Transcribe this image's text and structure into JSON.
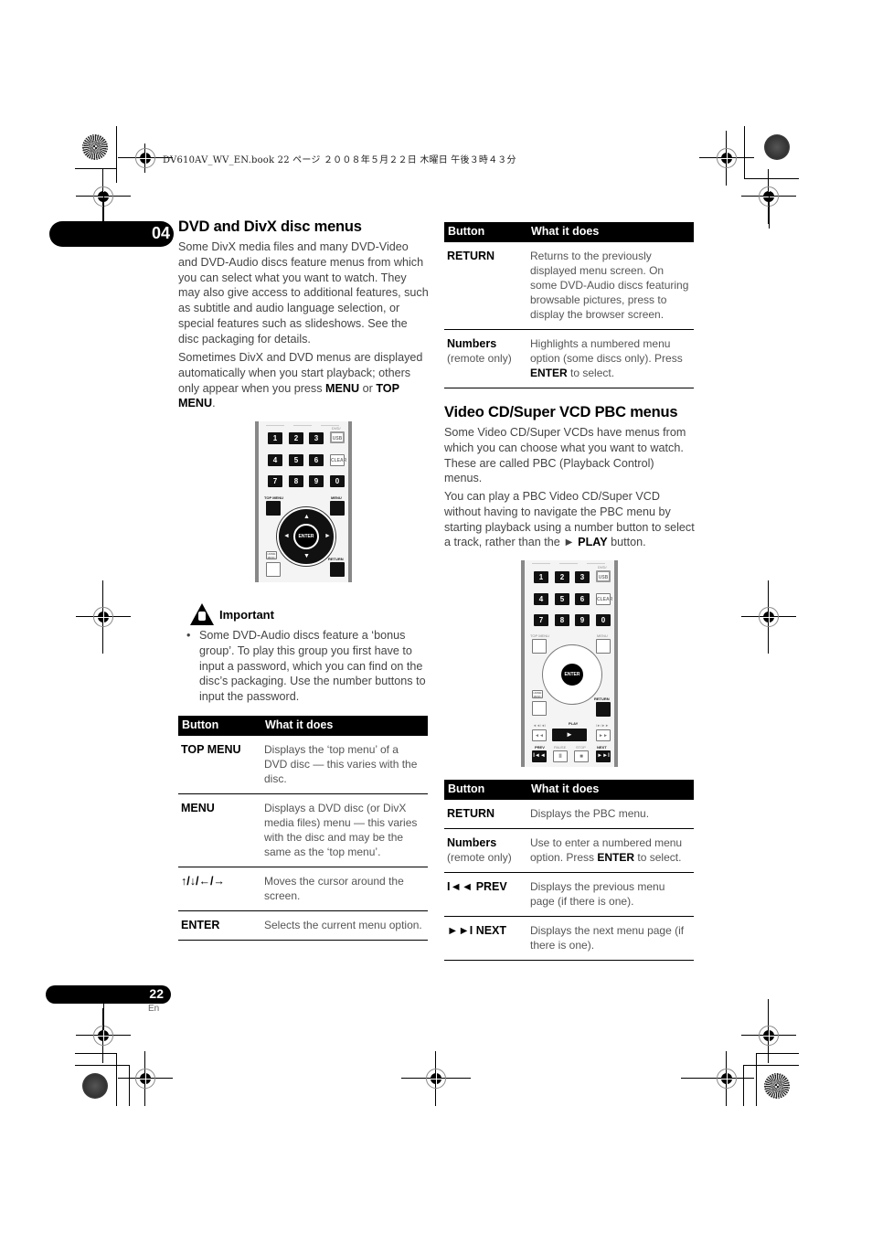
{
  "print_header": "DV610AV_WV_EN.book  22 ページ  ２００８年５月２２日  木曜日  午後３時４３分",
  "chapter": "04",
  "page": {
    "number": "22",
    "lang": "En"
  },
  "left": {
    "heading": "DVD and DivX disc menus",
    "para1": "Some DivX media files and many DVD-Video and DVD-Audio discs feature menus from which you can select what you want to watch. They may also give access to additional features, such as subtitle and audio language selection, or special features such as slideshows. See the disc packaging for details.",
    "para2_pre": "Sometimes DivX and DVD menus are displayed automatically when you start playback; others only appear when you press ",
    "para2_b1": "MENU",
    "para2_mid": " or ",
    "para2_b2": "TOP MENU",
    "para2_end": ".",
    "remote": {
      "keys": [
        "1",
        "2",
        "3",
        "4",
        "5",
        "6",
        "7",
        "8",
        "9",
        "0"
      ],
      "dvd_usb_top": "DVD/",
      "usb": "USB",
      "clear": "CLEAR",
      "top_menu": "TOP MENU",
      "menu": "MENU",
      "enter": "ENTER",
      "home_menu": "HOME MENU",
      "return": "RETURN"
    },
    "important": {
      "title": "Important",
      "bullets": [
        "Some DVD-Audio discs feature a ‘bonus group’. To play this group you first have to input a password, which you can find on the disc’s packaging. Use the number buttons to input the password."
      ]
    },
    "table": {
      "headers": [
        "Button",
        "What it does"
      ],
      "rows": [
        {
          "button": "TOP MENU",
          "desc": "Displays the ‘top menu’ of a DVD disc — this varies with the disc."
        },
        {
          "button": "MENU",
          "desc": "Displays a DVD disc (or DivX media files) menu — this varies with the disc and may be the same as the ‘top menu’."
        },
        {
          "button": "↑/↓/←/→",
          "desc": "Moves the cursor around the screen."
        },
        {
          "button": "ENTER",
          "desc": "Selects the current menu option."
        }
      ]
    }
  },
  "right": {
    "table1": {
      "headers": [
        "Button",
        "What it does"
      ],
      "rows": [
        {
          "button": "RETURN",
          "desc": "Returns to the previously displayed menu screen. On some DVD-Audio discs featuring browsable pictures, press to display the browser screen."
        },
        {
          "button": "Numbers",
          "sub": "(remote only)",
          "desc_pre": "Highlights a numbered menu option (some discs only). Press ",
          "desc_b": "ENTER",
          "desc_post": " to select."
        }
      ]
    },
    "heading": "Video CD/Super VCD PBC menus",
    "para1": "Some Video CD/Super VCDs have menus from which you can choose what you want to watch. These are called PBC (Playback Control) menus.",
    "para2_pre": "You can play a PBC Video CD/Super VCD without having to navigate the PBC menu by starting playback using a number button to select a track, rather than the ► ",
    "para2_b": "PLAY",
    "para2_post": " button.",
    "remote": {
      "keys": [
        "1",
        "2",
        "3",
        "4",
        "5",
        "6",
        "7",
        "8",
        "9",
        "0"
      ],
      "dvd_usb_top": "DVD/",
      "usb": "USB",
      "clear": "CLEAR",
      "top_menu": "TOP MENU",
      "menu": "MENU",
      "enter": "ENTER",
      "home_menu": "HOME MENU",
      "return": "RETURN",
      "rev": "◄◄/◄I",
      "play": "PLAY",
      "fwd": "I►/►►",
      "prev": "PREV",
      "pause": "PAUSE",
      "stop": "STOP",
      "next": "NEXT",
      "play_glyph": "►",
      "prev_glyph": "I◄◄",
      "pause_glyph": "II",
      "stop_glyph": "■",
      "next_glyph": "►►I",
      "rev_glyph": "◄◄",
      "fwd_glyph": "►►"
    },
    "table2": {
      "headers": [
        "Button",
        "What it does"
      ],
      "rows": [
        {
          "button": "RETURN",
          "desc": "Displays the PBC menu."
        },
        {
          "button": "Numbers",
          "sub": "(remote only)",
          "desc_pre": "Use to enter a numbered menu option. Press ",
          "desc_b": "ENTER",
          "desc_post": " to select."
        },
        {
          "button": "I◄◄ PREV",
          "desc": "Displays the previous menu page (if there is one)."
        },
        {
          "button": "►►I NEXT",
          "desc": "Displays the next menu page (if there is one)."
        }
      ]
    }
  }
}
